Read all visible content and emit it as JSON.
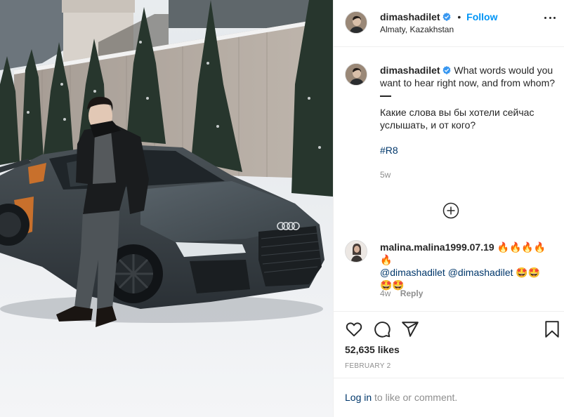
{
  "header": {
    "username": "dimashadilet",
    "separator": "•",
    "follow_label": "Follow",
    "location": "Almaty, Kazakhstan"
  },
  "caption": {
    "username": "dimashadilet",
    "text_en": "What words would you want to hear right now, and from whom?",
    "text_ru": "Какие слова вы бы хотели сейчас услышать, и от кого?",
    "hashtag": "#R8",
    "age": "5w"
  },
  "comment": {
    "username": "malina.malina1999.07.19",
    "emoji_a": "🔥🔥🔥🔥🔥",
    "mention_1": "@dimashadilet",
    "mention_2": "@dimashadilet",
    "emoji_b": "🤩🤩",
    "emoji_c": "🤩🤩",
    "age": "4w",
    "reply_label": "Reply"
  },
  "stats": {
    "likes": "52,635 likes",
    "date": "FEBRUARY 2"
  },
  "footer": {
    "login_link": "Log in",
    "login_rest": " to like or comment."
  },
  "icons": {
    "verified": "verified-badge-icon",
    "more": "more-options-icon",
    "load_more": "plus-circle-icon",
    "like": "heart-icon",
    "comment": "comment-icon",
    "share": "paper-plane-icon",
    "save": "bookmark-icon"
  },
  "colors": {
    "link_blue": "#0095f6",
    "verified_blue": "#3897f0",
    "hashtag_blue": "#00376b",
    "muted_gray": "#8e8e8e",
    "text": "#262626"
  }
}
